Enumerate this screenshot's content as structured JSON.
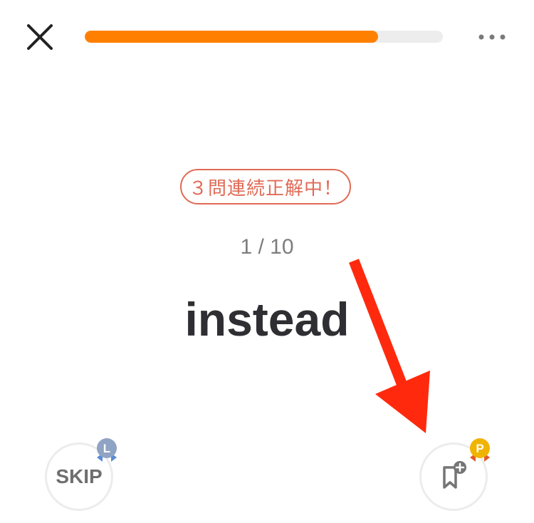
{
  "header": {
    "close_icon": "close-icon",
    "more_icon": "more-horizontal-icon",
    "progress": {
      "fraction": 0.82,
      "fill_color": "#ff8000",
      "track_color": "#ededed"
    }
  },
  "quiz": {
    "streak_text": "３問連続正解中！",
    "counter": "1 / 10",
    "word": "instead"
  },
  "actions": {
    "skip_label": "SKIP",
    "skip_badge_letter": "L",
    "bookmark_icon": "bookmark-add-icon",
    "bookmark_badge_letter": "P"
  },
  "colors": {
    "accent": "#ff8000",
    "streak": "#e06a55",
    "arrow": "#ff2a0e",
    "badge_l": "#8fa3c4",
    "badge_p": "#f0b400"
  }
}
